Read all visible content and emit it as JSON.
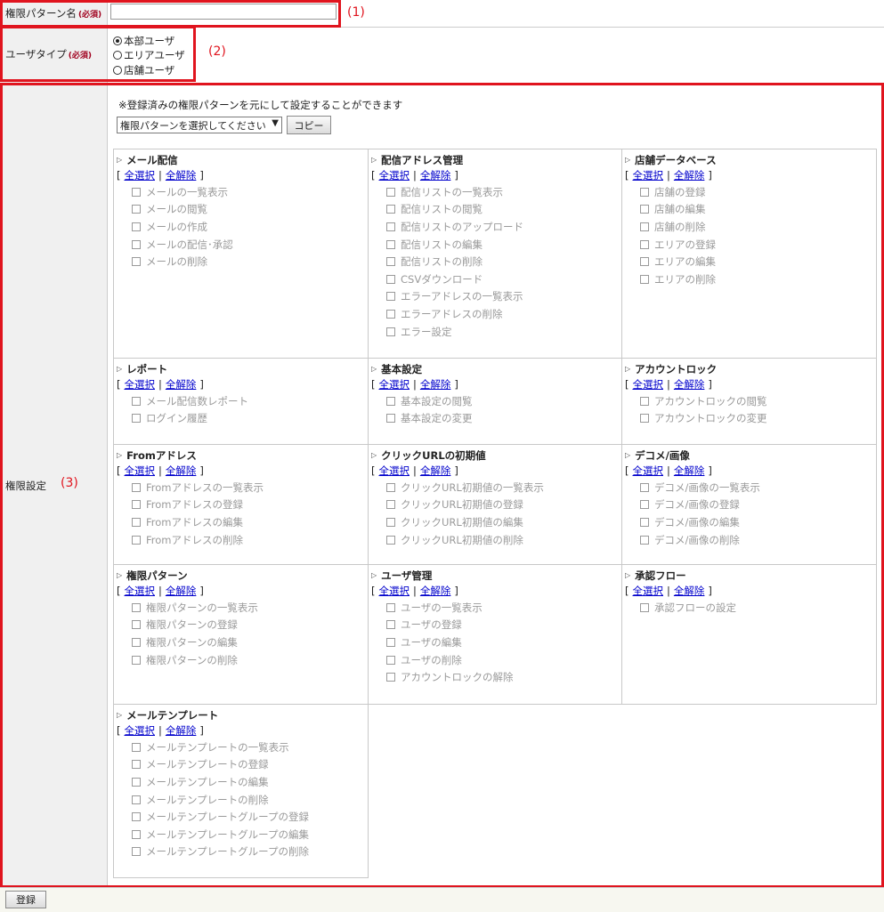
{
  "fields": {
    "pattern_name_label": "権限パターン名",
    "required_badge": "(必須)",
    "pattern_name_value": "",
    "user_type_label": "ユーザタイプ",
    "permission_label": "権限設定"
  },
  "annotations": {
    "a1": "(1)",
    "a2": "(2)",
    "a3": "(3)"
  },
  "user_types": [
    {
      "label": "本部ユーザ",
      "checked": true
    },
    {
      "label": "エリアユーザ",
      "checked": false
    },
    {
      "label": "店舗ユーザ",
      "checked": false
    }
  ],
  "copy_section": {
    "note": "※登録済みの権限パターンを元にして設定することができます",
    "select_value": "権限パターンを選択してください",
    "copy_button": "コピー"
  },
  "links": {
    "select_all": "全選択",
    "deselect_all": "全解除",
    "open": "[",
    "sep": "|",
    "close": "]"
  },
  "sections": [
    {
      "title": "メール配信",
      "items": [
        "メールの一覧表示",
        "メールの閲覧",
        "メールの作成",
        "メールの配信･承認",
        "メールの削除"
      ]
    },
    {
      "title": "配信アドレス管理",
      "items": [
        "配信リストの一覧表示",
        "配信リストの閲覧",
        "配信リストのアップロード",
        "配信リストの編集",
        "配信リストの削除",
        "CSVダウンロード",
        "エラーアドレスの一覧表示",
        "エラーアドレスの削除",
        "エラー設定"
      ]
    },
    {
      "title": "店舗データベース",
      "items": [
        "店舗の登録",
        "店舗の編集",
        "店舗の削除",
        "エリアの登録",
        "エリアの編集",
        "エリアの削除"
      ]
    },
    {
      "title": "レポート",
      "items": [
        "メール配信数レポート",
        "ログイン履歴"
      ]
    },
    {
      "title": "基本設定",
      "items": [
        "基本設定の閲覧",
        "基本設定の変更"
      ]
    },
    {
      "title": "アカウントロック",
      "items": [
        "アカウントロックの閲覧",
        "アカウントロックの変更"
      ]
    },
    {
      "title": "Fromアドレス",
      "items": [
        "Fromアドレスの一覧表示",
        "Fromアドレスの登録",
        "Fromアドレスの編集",
        "Fromアドレスの削除"
      ]
    },
    {
      "title": "クリックURLの初期値",
      "items": [
        "クリックURL初期値の一覧表示",
        "クリックURL初期値の登録",
        "クリックURL初期値の編集",
        "クリックURL初期値の削除"
      ]
    },
    {
      "title": "デコメ/画像",
      "items": [
        "デコメ/画像の一覧表示",
        "デコメ/画像の登録",
        "デコメ/画像の編集",
        "デコメ/画像の削除"
      ]
    },
    {
      "title": "権限パターン",
      "items": [
        "権限パターンの一覧表示",
        "権限パターンの登録",
        "権限パターンの編集",
        "権限パターンの削除"
      ]
    },
    {
      "title": "ユーザ管理",
      "items": [
        "ユーザの一覧表示",
        "ユーザの登録",
        "ユーザの編集",
        "ユーザの削除",
        "アカウントロックの解除"
      ]
    },
    {
      "title": "承認フロー",
      "items": [
        "承認フローの設定"
      ]
    },
    {
      "title": "メールテンプレート",
      "items": [
        "メールテンプレートの一覧表示",
        "メールテンプレートの登録",
        "メールテンプレートの編集",
        "メールテンプレートの削除",
        "メールテンプレートグループの登録",
        "メールテンプレートグループの編集",
        "メールテンプレートグループの削除"
      ]
    }
  ],
  "footer": {
    "register_button": "登録"
  },
  "colors": {
    "annotation_red": "#e0141e",
    "link_blue": "#0000cc"
  }
}
